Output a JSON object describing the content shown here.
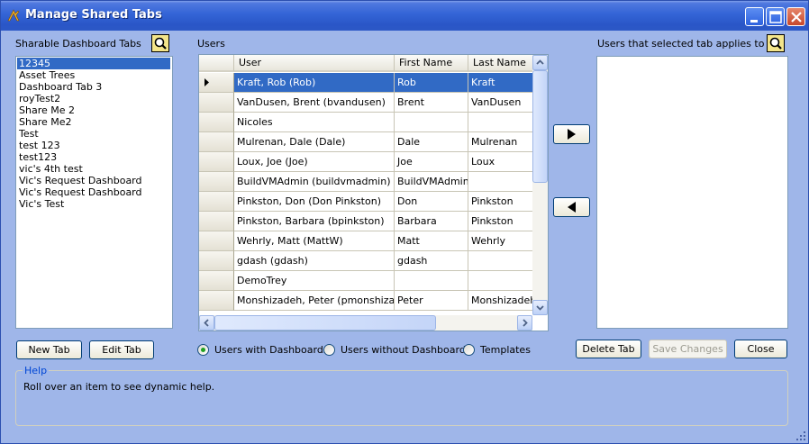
{
  "window": {
    "title": "Manage Shared Tabs"
  },
  "left_panel": {
    "label": "Sharable Dashboard Tabs",
    "tabs": [
      "12345",
      "Asset Trees",
      "Dashboard Tab 3",
      "royTest2",
      "Share Me 2",
      "Share Me2",
      "Test",
      "test 123",
      "test123",
      "vic's 4th test",
      "Vic's Request Dashboard",
      "Vic's Request Dashboard",
      "Vic's Test"
    ],
    "selected_index": 0
  },
  "users_panel": {
    "label": "Users",
    "columns": [
      "User",
      "First Name",
      "Last Name"
    ],
    "rows": [
      [
        "Kraft, Rob (Rob)",
        "Rob",
        "Kraft"
      ],
      [
        "VanDusen, Brent (bvandusen)",
        "Brent",
        "VanDusen"
      ],
      [
        "Nicoles",
        "",
        ""
      ],
      [
        "Mulrenan, Dale (Dale)",
        "Dale",
        "Mulrenan"
      ],
      [
        "Loux, Joe (Joe)",
        "Joe",
        "Loux"
      ],
      [
        "BuildVMAdmin (buildvmadmin)",
        "BuildVMAdmin",
        ""
      ],
      [
        "Pinkston, Don (Don Pinkston)",
        "Don",
        "Pinkston"
      ],
      [
        "Pinkston, Barbara (bpinkston)",
        "Barbara",
        "Pinkston"
      ],
      [
        "Wehrly, Matt (MattW)",
        "Matt",
        "Wehrly"
      ],
      [
        "gdash (gdash)",
        "gdash",
        ""
      ],
      [
        "DemoTrey",
        "",
        ""
      ],
      [
        "Monshizadeh, Peter (pmonshizadeh)",
        "Peter",
        "Monshizadeh"
      ]
    ],
    "selected_row": 0
  },
  "right_panel": {
    "label": "Users that selected tab applies to",
    "items": []
  },
  "buttons": {
    "new_tab": "New Tab",
    "edit_tab": "Edit Tab",
    "delete_tab": "Delete Tab",
    "save_changes": "Save Changes",
    "close": "Close"
  },
  "filters": {
    "options": [
      "Users with Dashboards",
      "Users without Dashboards",
      "Templates"
    ],
    "selected": "Users with Dashboards"
  },
  "help": {
    "title": "Help",
    "text": "Roll over an item to see dynamic help."
  },
  "colors": {
    "selection": "#316ac5",
    "title_bar": "#2a56c7",
    "client_bg": "#9fb6e9"
  }
}
